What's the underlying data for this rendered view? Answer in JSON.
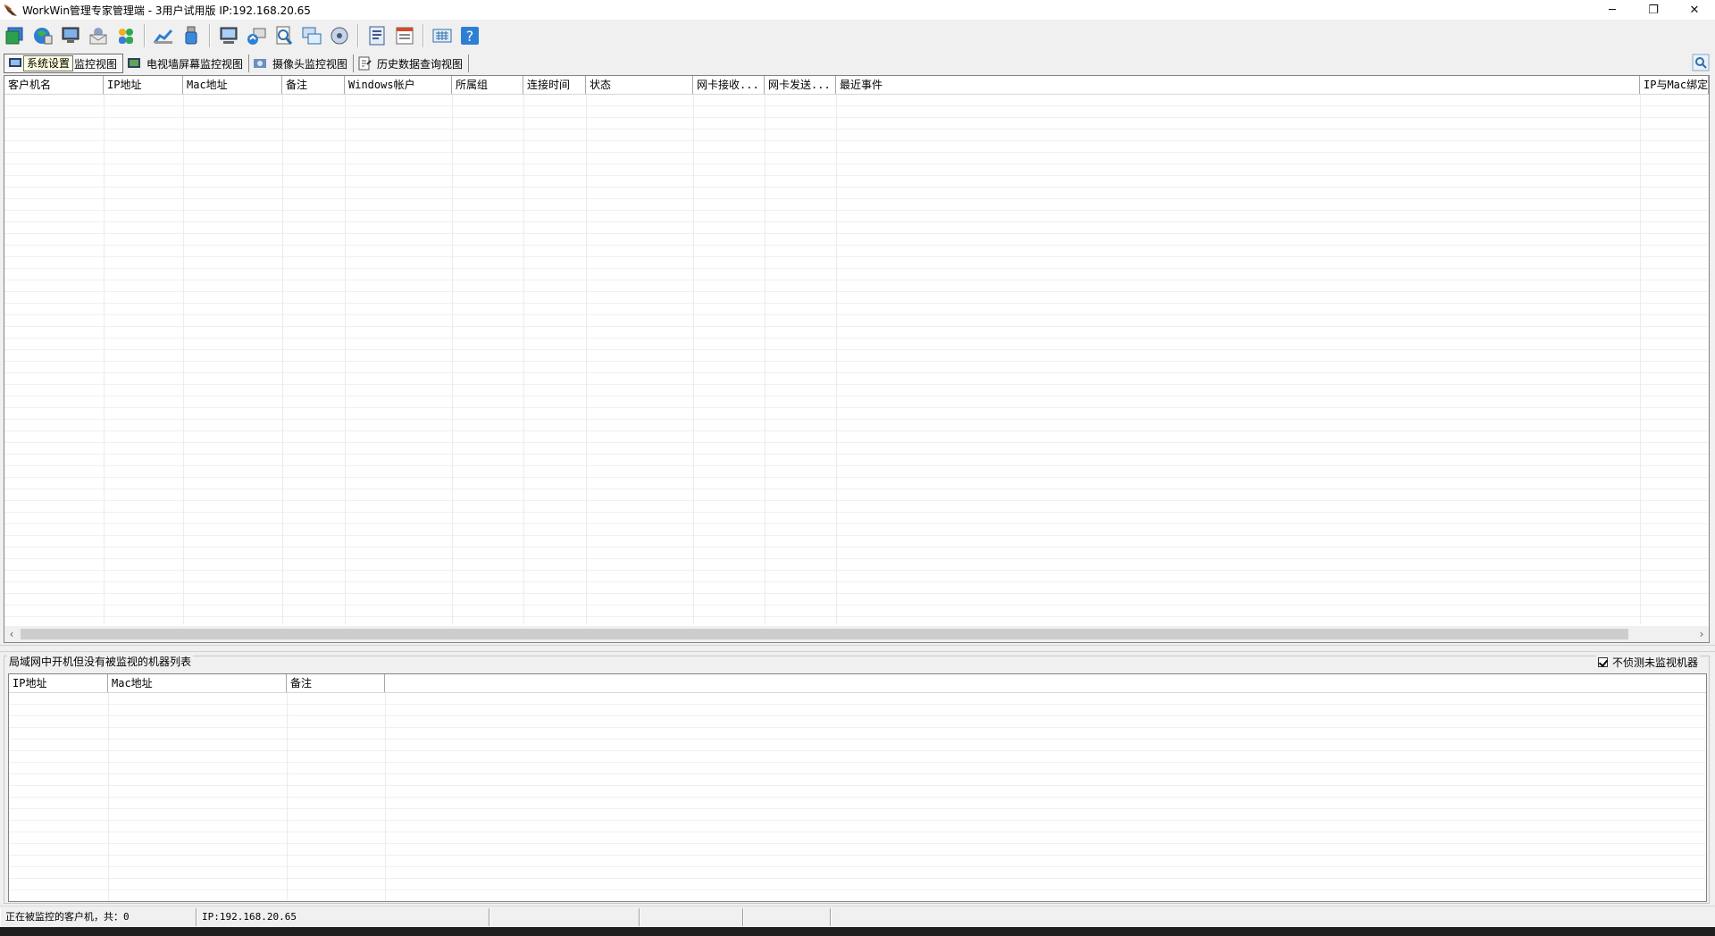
{
  "window": {
    "title": "WorkWin管理专家管理端 - 3用户试用版 IP:192.168.20.65",
    "minimize": "─",
    "restore": "❐",
    "close": "✕"
  },
  "toolbar": {
    "icons": [
      "console-icon",
      "network-globe-icon",
      "remote-screen-icon",
      "mail-icon",
      "users-icon",
      "chart-icon",
      "usb-icon",
      "monitor-icon",
      "broadcast-icon",
      "search-file-icon",
      "windows-icon",
      "disk-icon",
      "report-icon",
      "settings-list-icon",
      "keyboard-icon",
      "help-icon"
    ]
  },
  "tooltip": "系统设置",
  "tabs": [
    {
      "label": "监控视图",
      "icon": "screen-monitor-icon",
      "active": true
    },
    {
      "label": "电视墙屏幕监控视图",
      "icon": "tv-wall-icon",
      "active": false
    },
    {
      "label": "摄像头监控视图",
      "icon": "camera-icon",
      "active": false
    },
    {
      "label": "历史数据查询视图",
      "icon": "history-icon",
      "active": false
    }
  ],
  "main_grid": {
    "columns": [
      "客户机名",
      "IP地址",
      "Mac地址",
      "备注",
      "Windows帐户",
      "所属组",
      "连接时间",
      "状态",
      "网卡接收...",
      "网卡发送...",
      "最近事件",
      "IP与Mac绑定"
    ]
  },
  "bottom": {
    "group_title": "局域网中开机但没有被监视的机器列表",
    "checkbox_label": "不侦测未监视机器",
    "checkbox_checked": true,
    "columns": [
      "IP地址",
      "Mac地址",
      "备注"
    ]
  },
  "status": {
    "left": "正在被监控的客户机，共：0",
    "ip": "IP:192.168.20.65"
  }
}
